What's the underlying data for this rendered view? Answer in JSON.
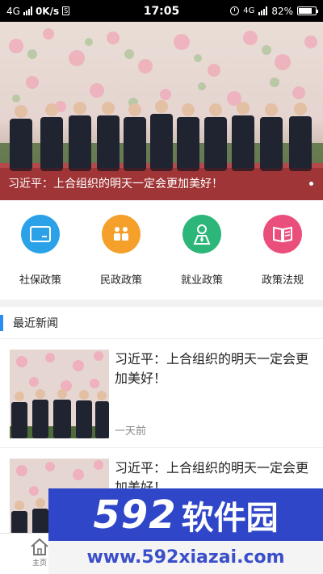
{
  "status_bar": {
    "network_left": "4G",
    "speed": "0K/s",
    "sim_label": "S",
    "time": "17:05",
    "network_right": "4G",
    "battery": "82%",
    "battery_level": 0.82
  },
  "banner": {
    "caption": "习近平：上合组织的明天一定会更加美好！"
  },
  "categories": [
    {
      "label": "社保政策",
      "icon": "card-icon",
      "color": "#2ba2e8"
    },
    {
      "label": "民政政策",
      "icon": "people-icon",
      "color": "#f5a02a"
    },
    {
      "label": "就业政策",
      "icon": "person-icon",
      "color": "#2db67a"
    },
    {
      "label": "政策法规",
      "icon": "book-icon",
      "color": "#ea4f7c"
    }
  ],
  "news": {
    "section_title": "最近新闻",
    "items": [
      {
        "title": "习近平：上合组织的明天一定会更加美好！",
        "time": "一天前"
      },
      {
        "title": "习近平：上合组织的明天一定会更加美好！",
        "time": ""
      }
    ]
  },
  "bottom_nav": {
    "home_label": "主页"
  },
  "watermark": {
    "number": "592",
    "cn": "软件园",
    "url": "www.592xiazai.com"
  },
  "colors": {
    "accent": "#2a8ef0",
    "watermark_blue": "#2f46c8"
  }
}
